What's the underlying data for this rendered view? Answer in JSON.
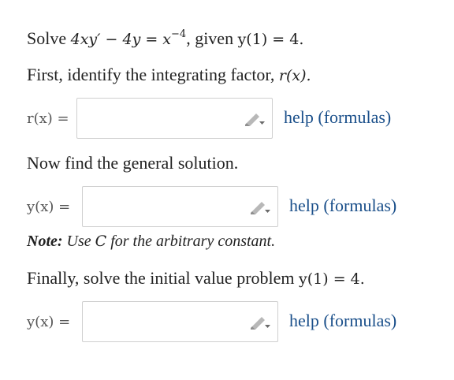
{
  "problem": {
    "solve_word": "Solve",
    "equation": "4xy′ − 4y = x",
    "exponent": "−4",
    "given_text": ", given",
    "initial": "y(1) = 4."
  },
  "step1": {
    "text": "First, identify the integrating factor,",
    "func": "r(x).",
    "field_label": "r(x) =",
    "field_value": "",
    "help_label": "help (formulas)"
  },
  "step2": {
    "text": "Now find the general solution.",
    "field_label": "y(x) =",
    "field_value": "",
    "help_label": "help (formulas)",
    "note_bold": "Note:",
    "note_pre": "Use",
    "note_var": "C",
    "note_post": "for the arbitrary constant."
  },
  "step3": {
    "text": "Finally, solve the initial value problem",
    "ivp": "y(1) = 4.",
    "field_label": "y(x) =",
    "field_value": "",
    "help_label": "help (formulas)"
  },
  "icons": {
    "pencil": "pencil-icon"
  }
}
